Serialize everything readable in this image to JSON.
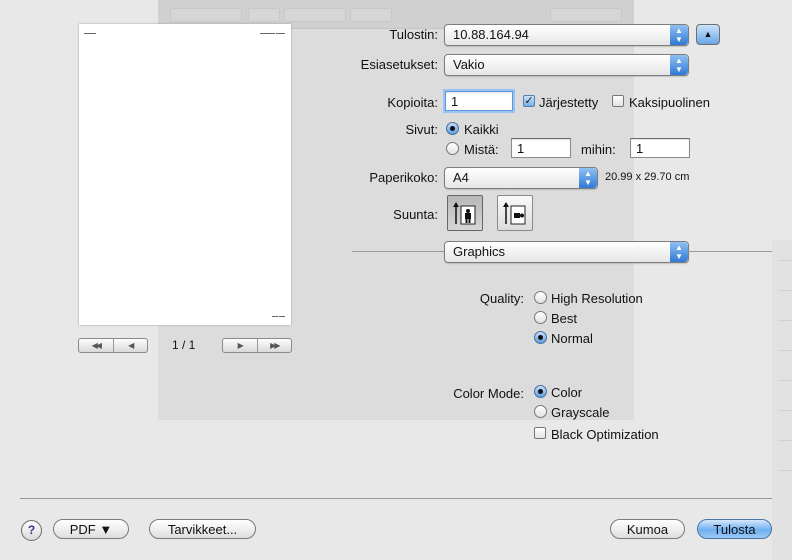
{
  "printer": {
    "label": "Tulostin:",
    "value": "10.88.164.94"
  },
  "presets": {
    "label": "Esiasetukset:",
    "value": "Vakio"
  },
  "copies": {
    "label": "Kopioita:",
    "value": "1",
    "collated_label": "Järjestetty",
    "collated": true,
    "twosided_label": "Kaksipuolinen",
    "twosided": false
  },
  "pages": {
    "label": "Sivut:",
    "all_label": "Kaikki",
    "from_label": "Mistä:",
    "from_value": "1",
    "to_label": "mihin:",
    "to_value": "1",
    "selected": "all"
  },
  "paper": {
    "label": "Paperikoko:",
    "value": "A4",
    "size_text": "20.99 x 29.70 cm"
  },
  "orientation": {
    "label": "Suunta:",
    "selected": "portrait"
  },
  "panel": {
    "value": "Graphics"
  },
  "quality": {
    "label": "Quality:",
    "options": [
      "High Resolution",
      "Best",
      "Normal"
    ],
    "selected": "Normal"
  },
  "color_mode": {
    "label": "Color Mode:",
    "options": [
      "Color",
      "Grayscale"
    ],
    "selected": "Color",
    "black_opt_label": "Black Optimization",
    "black_opt": false
  },
  "preview": {
    "page_indicator": "1 / 1"
  },
  "buttons": {
    "help": "?",
    "pdf": "PDF ▼",
    "supplies": "Tarvikkeet...",
    "cancel": "Kumoa",
    "print": "Tulosta"
  },
  "colors": {
    "accent": "#5b9ae3",
    "default_button": "#6fb0f0"
  }
}
